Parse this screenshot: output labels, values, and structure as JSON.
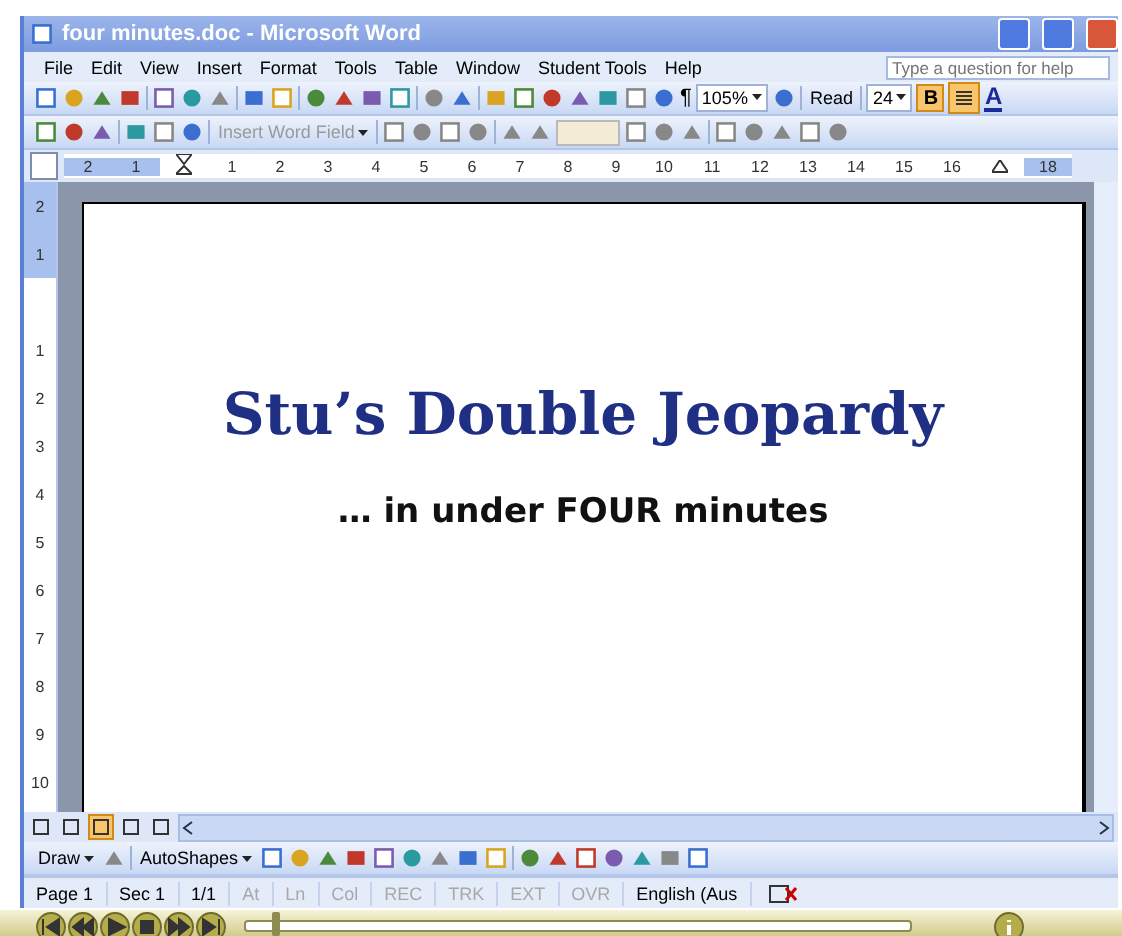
{
  "window": {
    "title": "four minutes.doc - Microsoft Word"
  },
  "menu": [
    "File",
    "Edit",
    "View",
    "Insert",
    "Format",
    "Tools",
    "Table",
    "Window",
    "Student Tools",
    "Help"
  ],
  "help_box": {
    "placeholder": "Type a question for help"
  },
  "standard_toolbar": {
    "pilcrow": "¶",
    "zoom": "105%",
    "read": "Read",
    "font_size": "24",
    "bold": {
      "label": "B",
      "on": true
    },
    "align": {
      "on": true
    },
    "font_color": "A"
  },
  "mail_merge_toolbar": {
    "insert_word_field": "Insert Word Field"
  },
  "ruler": {
    "left_labels": [
      "2",
      "1"
    ],
    "right_labels": [
      "1",
      "2",
      "3",
      "4",
      "5",
      "6",
      "7",
      "8",
      "9",
      "10",
      "11",
      "12",
      "13",
      "14",
      "15",
      "16"
    ],
    "end_labels": [
      "18"
    ]
  },
  "vertical_ruler": {
    "top_labels": [
      "2",
      "1"
    ],
    "labels": [
      "1",
      "2",
      "3",
      "4",
      "5",
      "6",
      "7",
      "8",
      "9",
      "10"
    ]
  },
  "document": {
    "heading": "Stu’s Double Jeopardy",
    "subtitle": "… in under FOUR minutes"
  },
  "view_buttons": [
    {
      "selected": false
    },
    {
      "selected": false
    },
    {
      "selected": true
    },
    {
      "selected": false
    },
    {
      "selected": false
    }
  ],
  "drawing_toolbar": {
    "draw": "Draw",
    "autoshapes": "AutoShapes"
  },
  "status_bar": [
    {
      "text": "Page 1",
      "disabled": false
    },
    {
      "text": "Sec 1",
      "disabled": false
    },
    {
      "text": "1/1",
      "disabled": false
    },
    {
      "text": "At",
      "disabled": true
    },
    {
      "text": "Ln",
      "disabled": true
    },
    {
      "text": "Col",
      "disabled": true
    },
    {
      "text": "REC",
      "disabled": true
    },
    {
      "text": "TRK",
      "disabled": true
    },
    {
      "text": "EXT",
      "disabled": true
    },
    {
      "text": "OVR",
      "disabled": true
    },
    {
      "text": "English (Aus",
      "disabled": false
    }
  ],
  "player": {
    "level": 0.04
  }
}
